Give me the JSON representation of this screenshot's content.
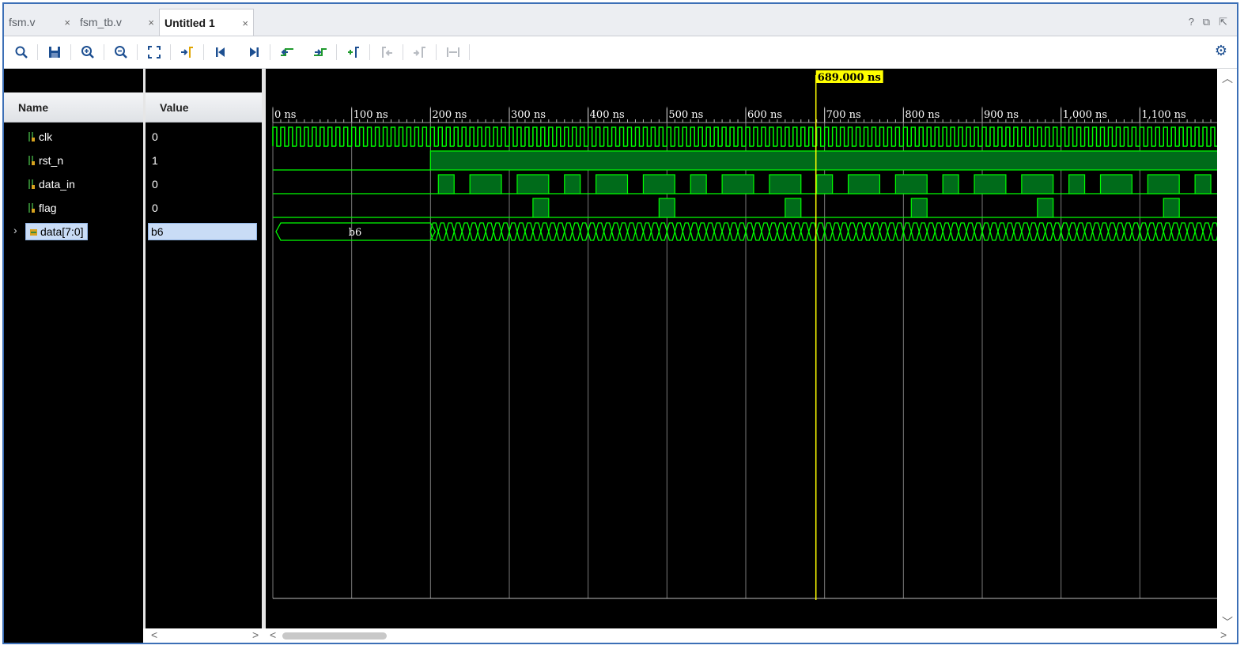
{
  "tabs": [
    {
      "label": "fsm.v",
      "close": "×",
      "active": false
    },
    {
      "label": "fsm_tb.v",
      "close": "×",
      "active": false
    },
    {
      "label": "Untitled 1",
      "close": "×",
      "active": true
    }
  ],
  "window_controls": {
    "help": "?",
    "restore": "⧉",
    "float": "⇱"
  },
  "toolbar_icons": [
    "search-icon",
    "save-icon",
    "zoom-in-icon",
    "zoom-out-icon",
    "zoom-fit-icon",
    "go-to-cursor-icon",
    "go-to-time-zero-icon",
    "go-to-last-time-icon",
    "previous-transition-icon",
    "next-transition-icon",
    "add-marker-icon",
    "previous-marker-icon",
    "next-marker-icon",
    "swap-cursors-icon"
  ],
  "columns": {
    "name": "Name",
    "value": "Value"
  },
  "signals": [
    {
      "name": "clk",
      "value": "0",
      "icon": "bit-signal-icon"
    },
    {
      "name": "rst_n",
      "value": "1",
      "icon": "bit-signal-icon"
    },
    {
      "name": "data_in",
      "value": "0",
      "icon": "bit-signal-icon"
    },
    {
      "name": "flag",
      "value": "0",
      "icon": "bit-signal-icon"
    },
    {
      "name": "data[7:0]",
      "value": "b6",
      "icon": "bus-signal-icon",
      "expandable": true,
      "selected": true
    }
  ],
  "timeline": {
    "cursor_label": "689.000 ns",
    "cursor_ns": 689,
    "view_start_ns": 0,
    "view_end_ns": 1200,
    "ticks": [
      "0 ns",
      "100 ns",
      "200 ns",
      "300 ns",
      "400 ns",
      "500 ns",
      "600 ns",
      "700 ns",
      "800 ns",
      "900 ns",
      "1,000 ns",
      "1,100 ns"
    ],
    "clk_period_ns": 10,
    "reset_release_ns": 200,
    "bus_initial_label": "b6",
    "bus_change_period_ns": 10,
    "data_in_high_intervals_ns": [
      [
        210,
        230
      ],
      [
        250,
        290
      ],
      [
        310,
        350
      ],
      [
        370,
        390
      ],
      [
        410,
        450
      ],
      [
        470,
        510
      ],
      [
        530,
        550
      ],
      [
        570,
        610
      ],
      [
        630,
        670
      ],
      [
        690,
        710
      ],
      [
        730,
        770
      ],
      [
        790,
        830
      ],
      [
        850,
        870
      ],
      [
        890,
        930
      ],
      [
        950,
        990
      ],
      [
        1010,
        1030
      ],
      [
        1050,
        1090
      ],
      [
        1110,
        1150
      ],
      [
        1170,
        1190
      ]
    ],
    "flag_high_intervals_ns": [
      [
        330,
        350
      ],
      [
        490,
        510
      ],
      [
        650,
        670
      ],
      [
        810,
        830
      ],
      [
        970,
        990
      ],
      [
        1130,
        1150
      ]
    ]
  },
  "colors": {
    "wave": "#00ff00",
    "fill": "#006b1a",
    "cursor": "#ffff00",
    "grid": "#7a7a7a",
    "accent": "#1d4f91"
  }
}
